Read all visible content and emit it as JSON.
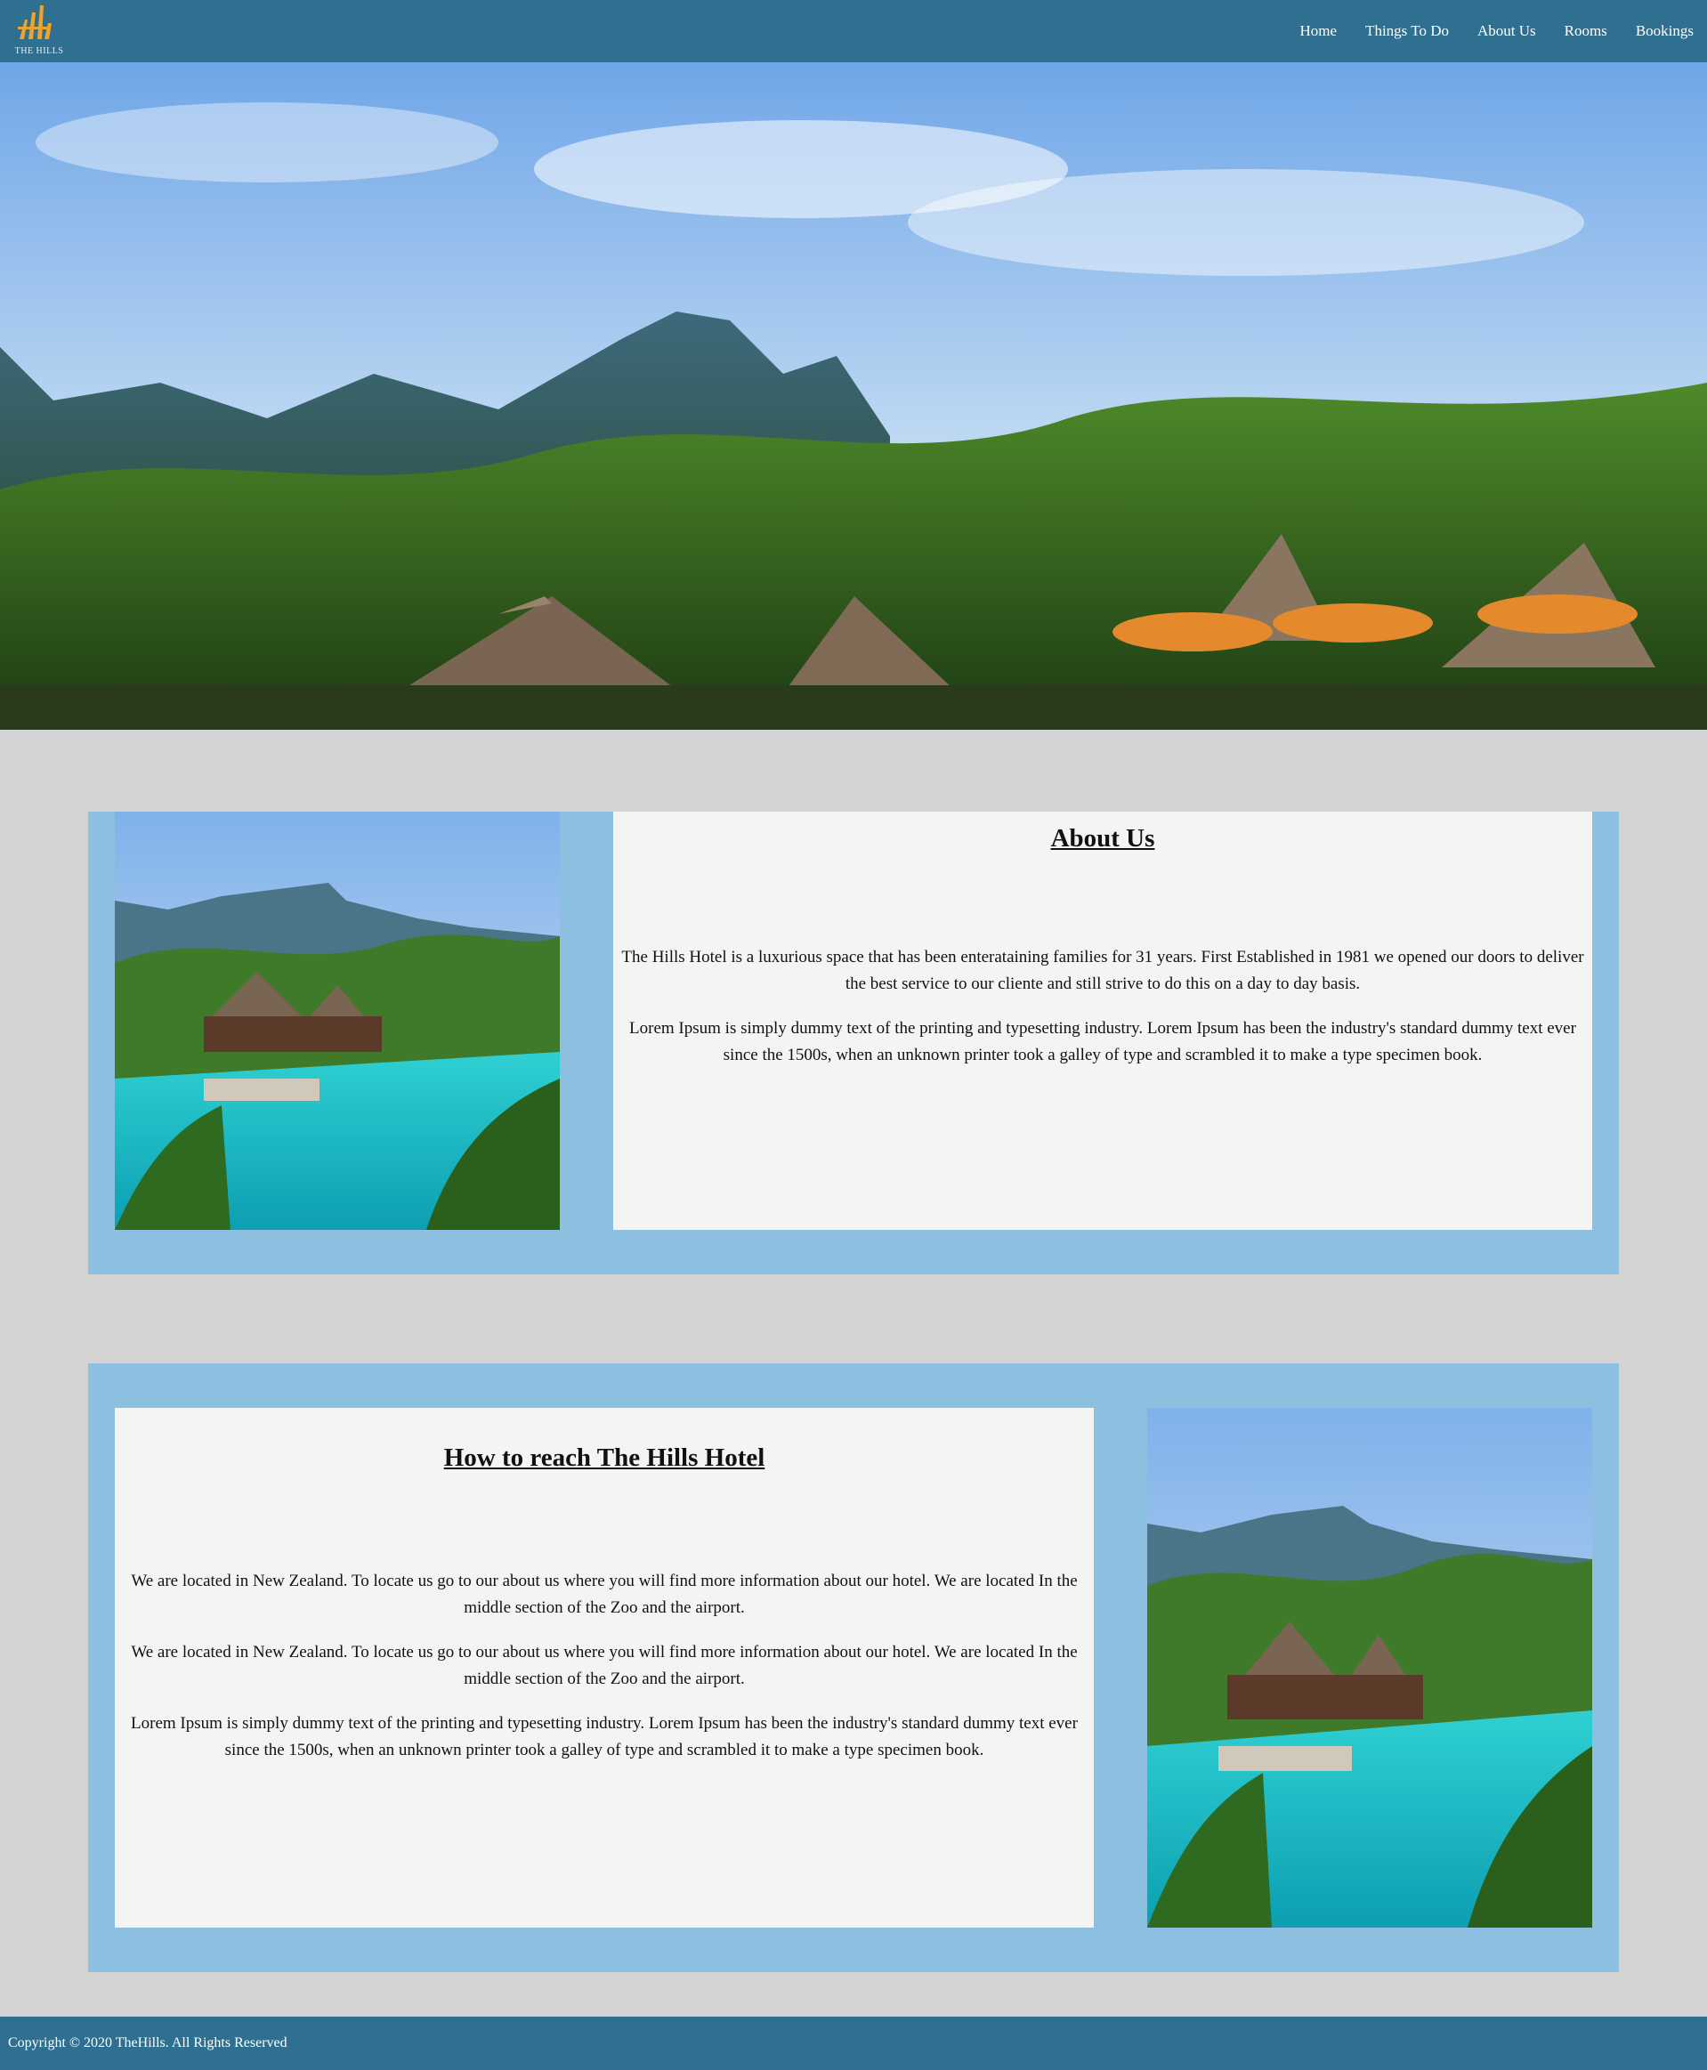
{
  "header": {
    "logo_text": "THE HILLS",
    "nav": [
      "Home",
      "Things To Do",
      "About Us",
      "Rooms",
      "Bookings"
    ]
  },
  "about": {
    "title": "About Us",
    "paragraphs": [
      "The Hills Hotel is a luxurious space that has been enterataining families for 31 years. First Established in 1981 we opened our doors to deliver the best service to our cliente and still strive to do this on a day to day basis.",
      "Lorem Ipsum is simply dummy text of the printing and typesetting industry. Lorem Ipsum has been the industry's standard dummy text ever since the 1500s, when an unknown printer took a galley of type and scrambled it to make a type specimen book."
    ]
  },
  "reach": {
    "title": "How to reach The Hills Hotel",
    "paragraphs": [
      "We are located in New Zealand. To locate us go to our about us where you will find more information about our hotel. We are located In the middle section of the Zoo and the airport.",
      "We are located in New Zealand. To locate us go to our about us where you will find more information about our hotel. We are located In the middle section of the Zoo and the airport.",
      "Lorem Ipsum is simply dummy text of the printing and typesetting industry. Lorem Ipsum has been the industry's standard dummy text ever since the 1500s, when an unknown printer took a galley of type and scrambled it to make a type specimen book."
    ]
  },
  "footer": {
    "copyright": "Copyright © 2020 TheHills. All Rights Reserved"
  },
  "colors": {
    "header_bg": "#2f6f8f",
    "page_bg": "#d3d3d3",
    "panel_bg": "#8dbfe0",
    "card_bg": "#f4f4f4",
    "logo_accent": "#f0a32a"
  }
}
